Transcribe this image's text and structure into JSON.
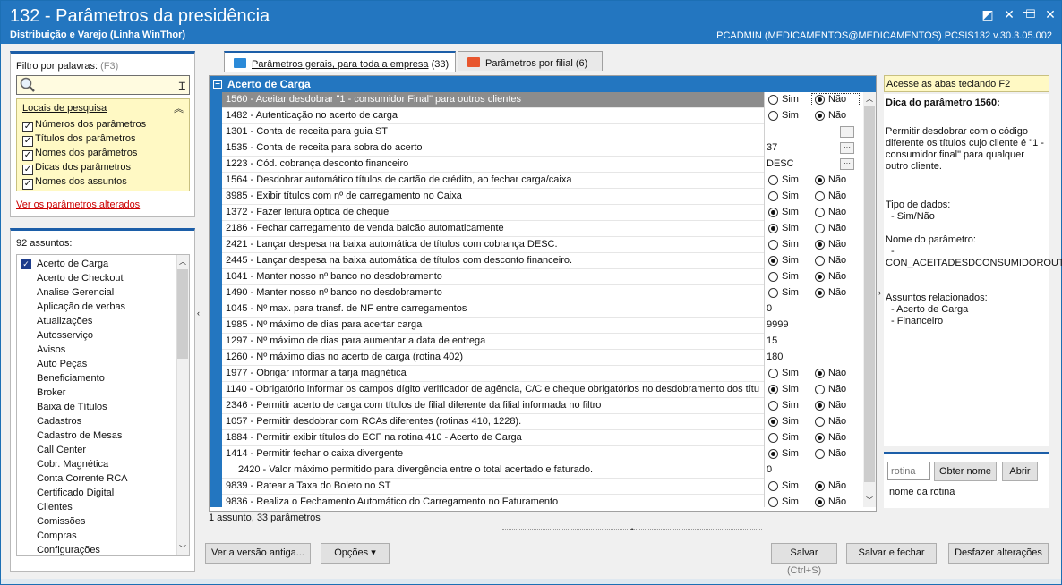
{
  "window": {
    "title": "132 - Parâmetros da presidência",
    "subtitle": "Distribuição e Varejo (Linha WinThor)",
    "user_info": "PCADMIN (MEDICAMENTOS@MEDICAMENTOS)   PCSIS132  v.30.3.05.002",
    "controls": {
      "edit": "◩",
      "close_x": "✕",
      "minimize": "—",
      "maximize": "☐",
      "close": "✕"
    }
  },
  "filter": {
    "label": "Filtro por palavras:",
    "hint": "(F3)",
    "search_value": "",
    "locais_title": "Locais de pesquisa",
    "locais": [
      "Números dos parâmetros",
      "Títulos dos parâmetros",
      "Nomes dos parâmetros",
      "Dicas dos parâmetros",
      "Nomes dos assuntos"
    ],
    "ver_alterados": "Ver os parâmetros alterados"
  },
  "subjects": {
    "count_label": "92 assuntos:",
    "items": [
      "Acerto de Carga",
      "Acerto de Checkout",
      "Analise Gerencial",
      "Aplicação de verbas",
      "Atualizações",
      "Autosserviço",
      "Avisos",
      "Auto Peças",
      "Beneficiamento",
      "Broker",
      "Baixa de Títulos",
      "Cadastros",
      "Cadastro de Mesas",
      "Call Center",
      "Cobr. Magnética",
      "Conta Corrente RCA",
      "Certificado Digital",
      "Clientes",
      "Comissões",
      "Compras",
      "Configurações"
    ]
  },
  "tabs": [
    {
      "label": "Parâmetros gerais, para toda a empresa",
      "count": "(33)",
      "color": "#2b8ad8"
    },
    {
      "label": "Parâmetros por filial",
      "count": "(6)",
      "color": "#e8562e"
    }
  ],
  "grid": {
    "group_title": "Acerto de Carga",
    "sim": "Sim",
    "nao": "Não",
    "rows": [
      {
        "name": "1560 - Aceitar desdobrar \"1 - consumidor Final\" para outros clientes",
        "kind": "radio",
        "value": "nao",
        "selected": true
      },
      {
        "name": "1482 - Autenticação no acerto de carga",
        "kind": "radio",
        "value": "nao"
      },
      {
        "name": "1301 - Conta de receita para guia ST",
        "kind": "text",
        "value": "",
        "ellipsis": true
      },
      {
        "name": "1535 - Conta de receita para sobra do acerto",
        "kind": "text",
        "value": "37",
        "ellipsis": true
      },
      {
        "name": "1223 - Cód. cobrança desconto financeiro",
        "kind": "text",
        "value": "DESC",
        "ellipsis": true
      },
      {
        "name": "1564 - Desdobrar automático títulos de cartão de crédito, ao fechar carga/caixa",
        "kind": "radio",
        "value": "nao"
      },
      {
        "name": "3985 - Exibir títulos com nº de carregamento no Caixa",
        "kind": "radio",
        "value": "none"
      },
      {
        "name": "1372 - Fazer leitura óptica de cheque",
        "kind": "radio",
        "value": "sim"
      },
      {
        "name": "2186 - Fechar carregamento de venda balcão automaticamente",
        "kind": "radio",
        "value": "sim"
      },
      {
        "name": "2421 - Lançar despesa na baixa automática de títulos com cobrança DESC.",
        "kind": "radio",
        "value": "nao"
      },
      {
        "name": "2445 - Lançar despesa na baixa automática de títulos com desconto financeiro.",
        "kind": "radio",
        "value": "sim"
      },
      {
        "name": "1041 - Manter nosso nº banco no desdobramento",
        "kind": "radio",
        "value": "nao"
      },
      {
        "name": "1490 - Manter nosso nº banco no desdobramento",
        "kind": "radio",
        "value": "nao"
      },
      {
        "name": "1045 - Nº max. para transf. de NF entre carregamentos",
        "kind": "text",
        "value": "0"
      },
      {
        "name": "1985 - Nº máximo de dias para acertar carga",
        "kind": "text",
        "value": "9999"
      },
      {
        "name": "1297 - Nº máximo de dias para aumentar a data de entrega",
        "kind": "text",
        "value": "15"
      },
      {
        "name": "1260 - Nº máximo dias no acerto de carga (rotina 402)",
        "kind": "text",
        "value": "180"
      },
      {
        "name": "1977 - Obrigar informar a tarja magnética",
        "kind": "radio",
        "value": "nao"
      },
      {
        "name": "1140 - Obrigatório informar os campos dígito verificador de agência, C/C e cheque obrigatórios no desdobramento dos títu",
        "kind": "radio",
        "value": "sim"
      },
      {
        "name": "2346 - Permitir acerto de carga com títulos de filial diferente da filial informada no filtro",
        "kind": "radio",
        "value": "nao"
      },
      {
        "name": "1057 - Permitir desdobrar com RCAs diferentes (rotinas 410, 1228).",
        "kind": "radio",
        "value": "sim"
      },
      {
        "name": "1884 - Permitir exibir títulos do ECF na rotina 410 - Acerto de Carga",
        "kind": "radio",
        "value": "nao"
      },
      {
        "name": "1414 - Permitir fechar o caixa divergente",
        "kind": "radio",
        "value": "sim"
      },
      {
        "name": "2420 - Valor máximo permitido para divergência entre o total acertado e faturado.",
        "kind": "text",
        "value": "0",
        "indent": true
      },
      {
        "name": "9839 - Ratear a Taxa do Boleto no ST",
        "kind": "radio",
        "value": "nao"
      },
      {
        "name": "9836 - Realiza o Fechamento Automático do Carregamento no Faturamento",
        "kind": "radio",
        "value": "nao"
      }
    ],
    "status": "1 assunto, 33 parâmetros"
  },
  "tip": {
    "banner": "Acesse as abas teclando F2",
    "title": "Dica do parâmetro 1560:",
    "description": "Permitir desdobrar com o código diferente os títulos cujo cliente é \"1 - consumidor final\" para qualquer outro cliente.",
    "data_type_label": "Tipo de dados:",
    "data_type": "- Sim/Não",
    "param_name_label": "Nome do parâmetro:",
    "param_name_dash": "-",
    "param_name": "CON_ACEITADESDCONSUMIDOROUT",
    "related_label": "Assuntos relacionados:",
    "related": [
      "- Acerto de Carga",
      "- Financeiro"
    ]
  },
  "rotina": {
    "placeholder": "rotina",
    "obter": "Obter nome",
    "abrir": "Abrir",
    "label": "nome da rotina"
  },
  "buttons": {
    "versao": "Ver a versão antiga...",
    "opcoes": "Opções ▾",
    "salvar": "Salvar",
    "salvar_fechar": "Salvar e fechar",
    "desfazer": "Desfazer alterações",
    "shortcut": "(Ctrl+S)"
  }
}
